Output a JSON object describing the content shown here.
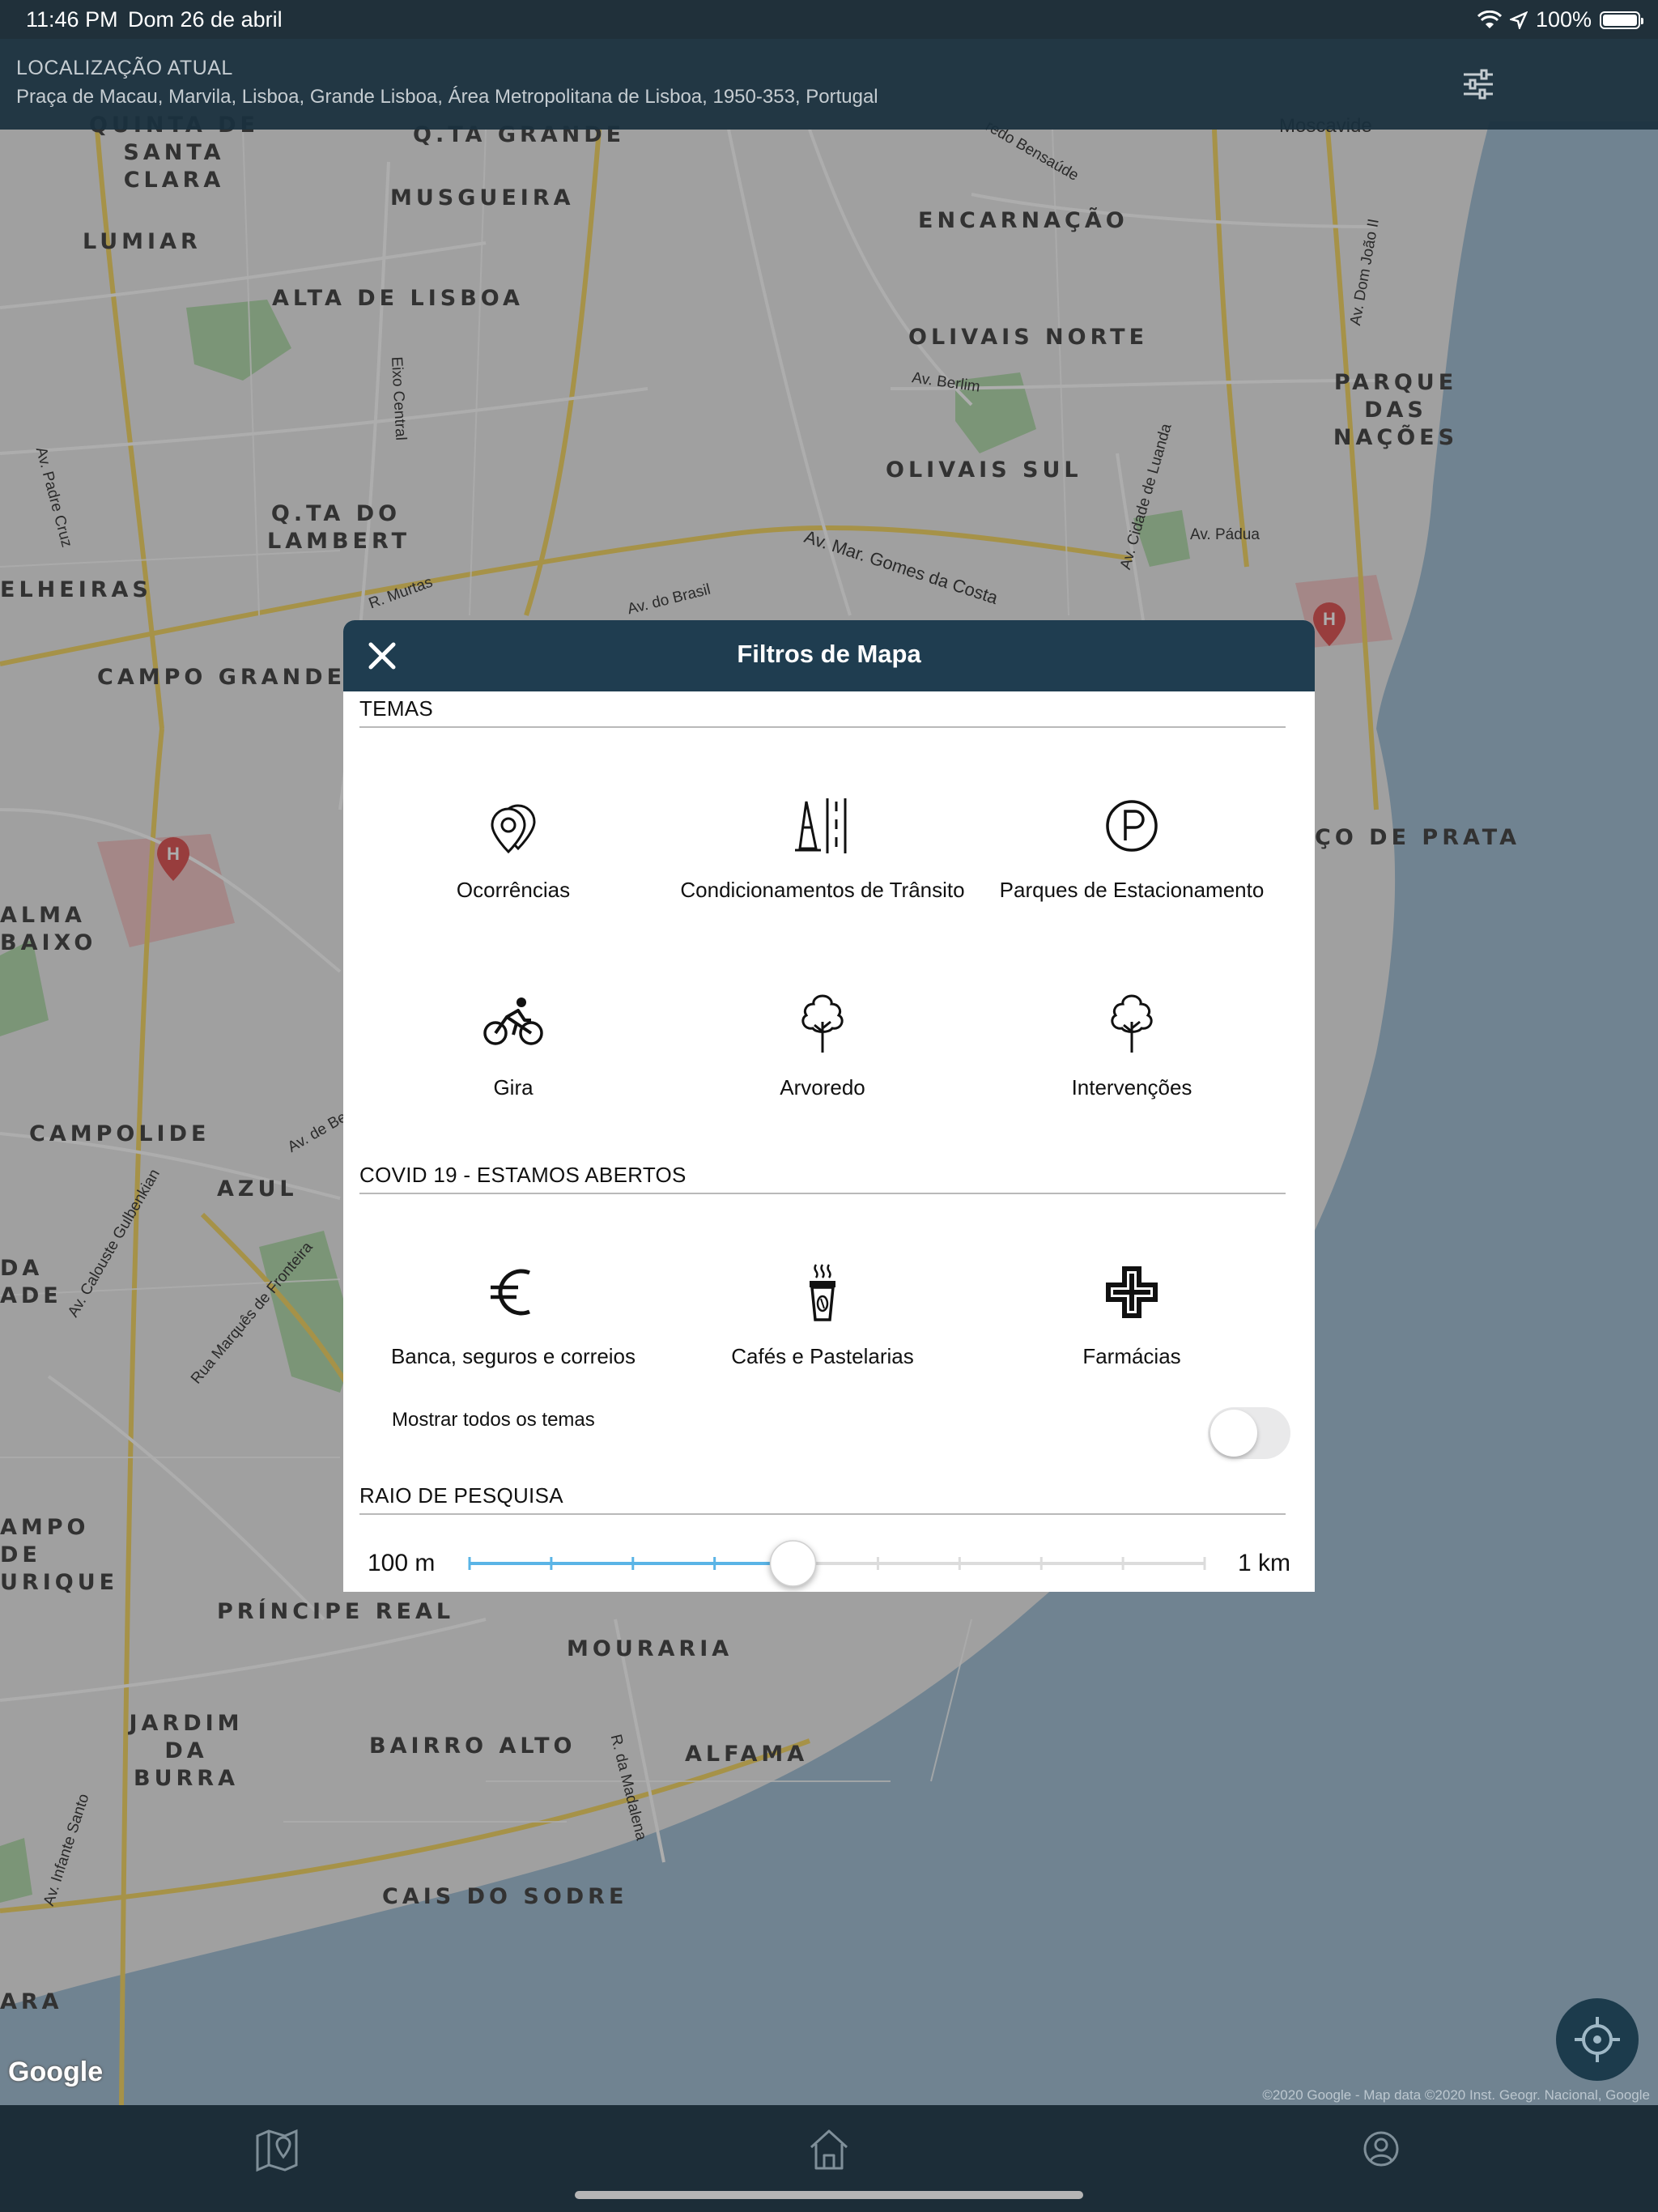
{
  "status_bar": {
    "time": "11:46 PM",
    "date": "Dom 26 de abril",
    "battery": "100%"
  },
  "location_header": {
    "title": "LOCALIZAÇÃO ATUAL",
    "address": "Praça de Macau, Marvila, Lisboa, Grande Lisboa, Área Metropolitana de Lisboa, 1950-353, Portugal",
    "filter_icon": "sliders-icon"
  },
  "map": {
    "neighborhoods": [
      "QUINTA DE SANTA CLARA",
      "Q.TA GRANDE",
      "MUSGUEIRA",
      "ENCARNAÇÃO",
      "LUMIAR",
      "ALTA DE LISBOA",
      "OLIVAIS NORTE",
      "PARQUE DAS NAÇÕES",
      "OLIVAIS SUL",
      "Q.TA DO LAMBERT",
      "ELHEIRAS",
      "CAMPO GRANDE",
      "ÇO DE PRATA",
      "ALMA BAIXO",
      "CAMPOLIDE",
      "AZUL",
      "DA ADE",
      "AMPO DE URIQUE",
      "PRÍNCIPE REAL",
      "MOURARIA",
      "JARDIM DA BURRA",
      "BAIRRO ALTO",
      "ALFAMA",
      "CAIS DO SODRE",
      "ARA"
    ],
    "streets": [
      "Av. Padre Cruz",
      "Eixo Central",
      "Av. Berlim",
      "Av. Mar. Gomes da Costa",
      "Av. do Brasil",
      "R. Murtas",
      "Av. Dom João II",
      "Av. Cidade de Luanda",
      "Av. Pádua",
      "Av. Calouste Gulbenkian",
      "Rua Marquês de Fronteira",
      "R. da Madalena",
      "Av. Infante Santo",
      "Av. de Be",
      "redo Bensaúde",
      "Moscavide"
    ],
    "google_logo": "Google",
    "attribution": "©2020 Google - Map data ©2020 Inst. Geogr. Nacional, Google"
  },
  "modal": {
    "title": "Filtros de Mapa",
    "close_icon": "close-icon",
    "sections": {
      "temas": "TEMAS",
      "covid": "COVID 19 - ESTAMOS ABERTOS",
      "raio": "RAIO DE PESQUISA"
    },
    "temas": [
      {
        "label": "Ocorrências",
        "icon": "map-pins-icon"
      },
      {
        "label": "Condicionamentos de Trânsito",
        "icon": "traffic-cone-icon"
      },
      {
        "label": "Parques de Estacionamento",
        "icon": "parking-icon"
      },
      {
        "label": "Gira",
        "icon": "bicycle-icon"
      },
      {
        "label": "Arvoredo",
        "icon": "tree-icon"
      },
      {
        "label": "Intervenções",
        "icon": "tree-outline-icon"
      }
    ],
    "covid": [
      {
        "label": "Banca, seguros e correios",
        "icon": "euro-icon"
      },
      {
        "label": "Cafés e Pastelarias",
        "icon": "coffee-cup-icon"
      },
      {
        "label": "Farmácias",
        "icon": "pharmacy-cross-icon"
      }
    ],
    "show_all": {
      "label": "Mostrar todos os temas",
      "on": false
    },
    "radius": {
      "min_label": "100 m",
      "max_label": "1 km",
      "value_fraction": 0.44,
      "tick_count": 10
    }
  },
  "colors": {
    "header_bg": "#1f3d50",
    "tab_bar_bg": "#1c2d38",
    "slider_fill": "#5ab4e6",
    "water": "#5e7d93"
  },
  "tab_bar": {
    "tabs": [
      {
        "name": "map-tab",
        "icon": "map-pin-icon"
      },
      {
        "name": "home-tab",
        "icon": "home-icon"
      },
      {
        "name": "profile-tab",
        "icon": "user-icon"
      }
    ]
  }
}
